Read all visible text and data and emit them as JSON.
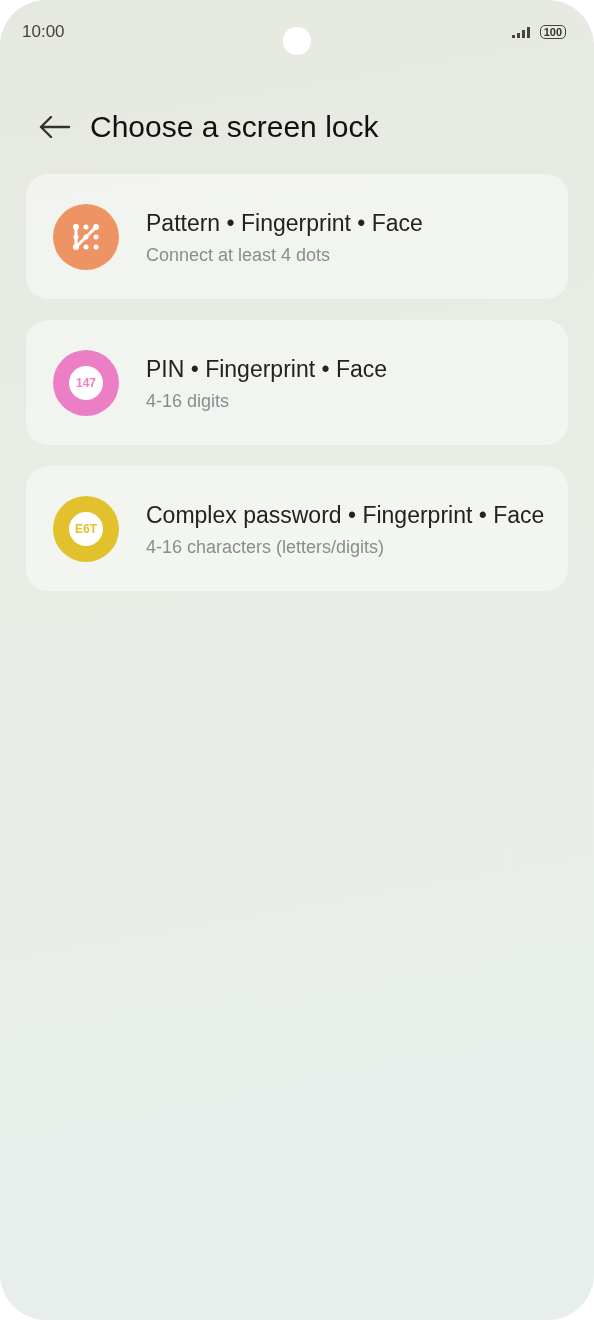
{
  "status_bar": {
    "time": "10:00",
    "battery": "100"
  },
  "header": {
    "title": "Choose a screen lock"
  },
  "options": [
    {
      "kind": "pattern",
      "color": "#ee9464",
      "title": "Pattern • Fingerprint • Face",
      "subtitle": "Connect at least 4 dots"
    },
    {
      "kind": "text",
      "color": "#ec7ec6",
      "icon_text": "147",
      "title": "PIN • Fingerprint • Face",
      "subtitle": "4-16 digits"
    },
    {
      "kind": "text",
      "color": "#e2c12c",
      "icon_text": "E6T",
      "title": "Complex password • Fingerprint • Face",
      "subtitle": "4-16 characters (letters/digits)"
    }
  ]
}
